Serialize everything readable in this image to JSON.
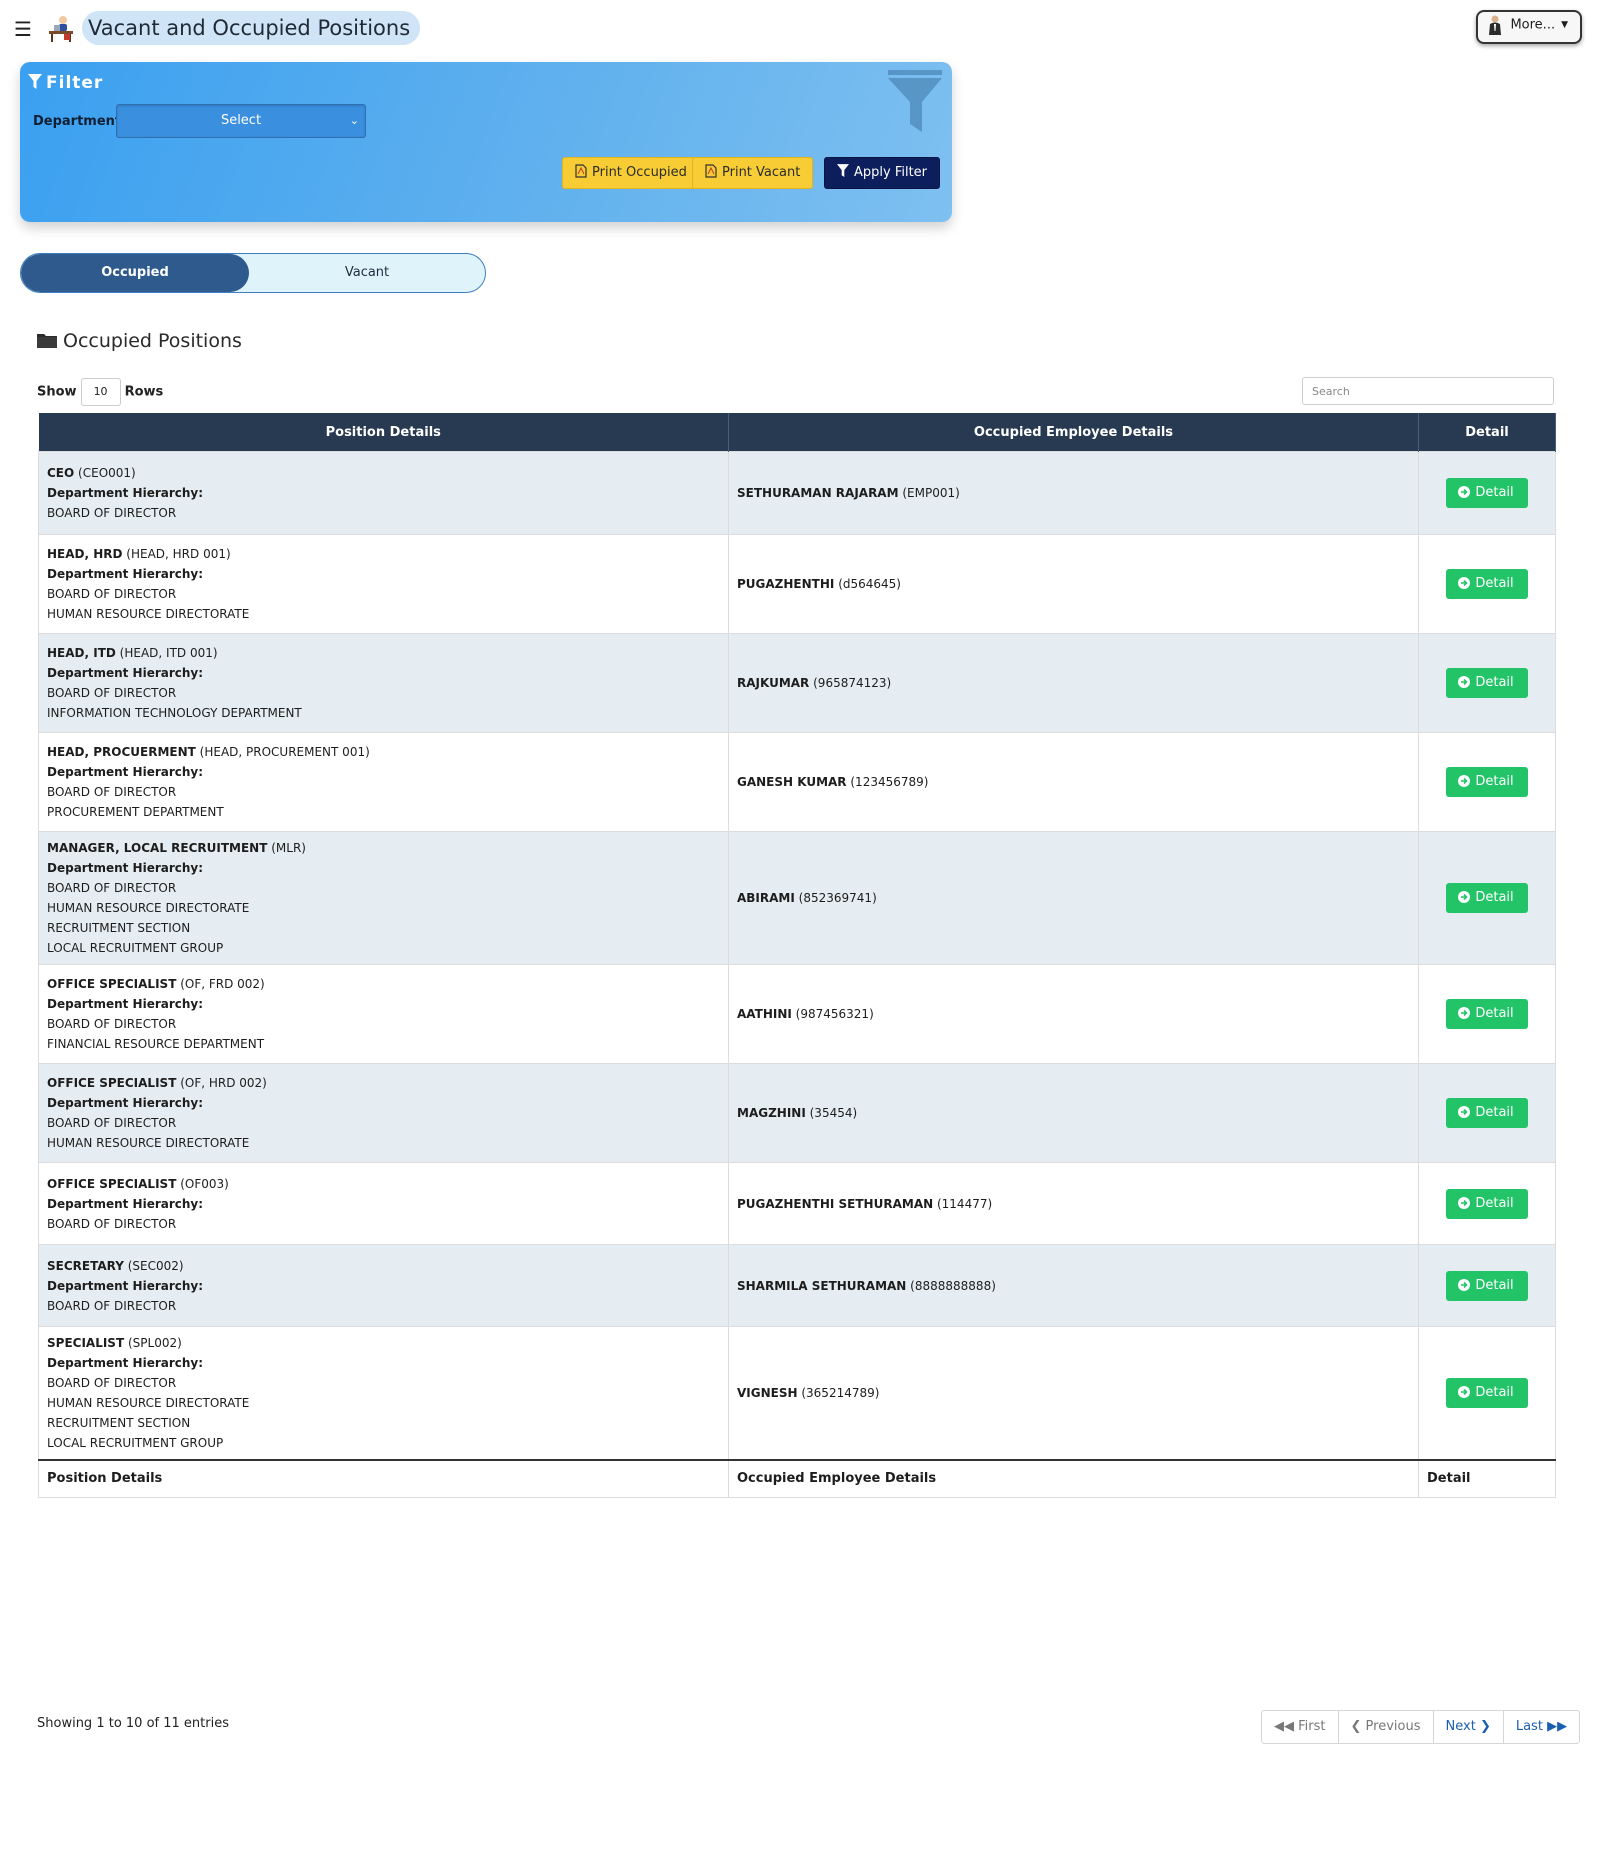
{
  "header": {
    "title": "Vacant and Occupied Positions",
    "more_label": "More..."
  },
  "filter": {
    "title": "Filter",
    "department_label": "Department:",
    "department_value": "Select",
    "print_occupied": "Print Occupied",
    "print_vacant": "Print Vacant",
    "apply_filter": "Apply Filter"
  },
  "toggle": {
    "occupied": "Occupied",
    "vacant": "Vacant"
  },
  "section": {
    "title": "Occupied Positions",
    "show_label": "Show",
    "rows_value": "10",
    "rows_label": "Rows",
    "search_placeholder": "Search"
  },
  "table": {
    "headers": [
      "Position Details",
      "Occupied Employee Details",
      "Detail"
    ],
    "hierarchy_label": "Department Hierarchy:",
    "detail_button": "Detail",
    "rows": [
      {
        "title": "CEO",
        "code": "(CEO001)",
        "hierarchy": [
          "BOARD OF DIRECTOR"
        ],
        "emp": "SETHURAMAN RAJARAM",
        "emp_id": "(EMP001)"
      },
      {
        "title": "HEAD, HRD",
        "code": "(HEAD, HRD 001)",
        "hierarchy": [
          "BOARD OF DIRECTOR",
          "HUMAN RESOURCE DIRECTORATE"
        ],
        "emp": "PUGAZHENTHI",
        "emp_id": "(d564645)"
      },
      {
        "title": "HEAD, ITD",
        "code": "(HEAD, ITD 001)",
        "hierarchy": [
          "BOARD OF DIRECTOR",
          "INFORMATION TECHNOLOGY DEPARTMENT"
        ],
        "emp": "RAJKUMAR",
        "emp_id": "(965874123)"
      },
      {
        "title": "HEAD, PROCUERMENT",
        "code": "(HEAD, PROCUREMENT 001)",
        "hierarchy": [
          "BOARD OF DIRECTOR",
          "PROCUREMENT DEPARTMENT"
        ],
        "emp": "GANESH KUMAR",
        "emp_id": "(123456789)"
      },
      {
        "title": "MANAGER, LOCAL RECRUITMENT",
        "code": "(MLR)",
        "hierarchy": [
          "BOARD OF DIRECTOR",
          "HUMAN RESOURCE DIRECTORATE",
          "RECRUITMENT SECTION",
          "LOCAL RECRUITMENT GROUP"
        ],
        "emp": "ABIRAMI",
        "emp_id": "(852369741)"
      },
      {
        "title": "OFFICE SPECIALIST",
        "code": "(OF, FRD 002)",
        "hierarchy": [
          "BOARD OF DIRECTOR",
          "FINANCIAL RESOURCE DEPARTMENT"
        ],
        "emp": "AATHINI",
        "emp_id": "(987456321)"
      },
      {
        "title": "OFFICE SPECIALIST",
        "code": "(OF, HRD 002)",
        "hierarchy": [
          "BOARD OF DIRECTOR",
          "HUMAN RESOURCE DIRECTORATE"
        ],
        "emp": "MAGZHINI",
        "emp_id": "(35454)"
      },
      {
        "title": "OFFICE SPECIALIST",
        "code": "(OF003)",
        "hierarchy": [
          "BOARD OF DIRECTOR"
        ],
        "emp": "PUGAZHENTHI SETHURAMAN",
        "emp_id": "(114477)"
      },
      {
        "title": "SECRETARY",
        "code": "(SEC002)",
        "hierarchy": [
          "BOARD OF DIRECTOR"
        ],
        "emp": "SHARMILA SETHURAMAN",
        "emp_id": "(8888888888)"
      },
      {
        "title": "SPECIALIST",
        "code": "(SPL002)",
        "hierarchy": [
          "BOARD OF DIRECTOR",
          "HUMAN RESOURCE DIRECTORATE",
          "RECRUITMENT SECTION",
          "LOCAL RECRUITMENT GROUP"
        ],
        "emp": "VIGNESH",
        "emp_id": "(365214789)"
      }
    ]
  },
  "footer": {
    "info": "Showing 1 to 10 of 11 entries",
    "first": "First",
    "previous": "Previous",
    "next": "Next",
    "last": "Last"
  },
  "colors": {
    "header_bg": "#273a52",
    "row_odd": "#e6edf2",
    "detail_green": "#23c468",
    "print_yellow": "#f7cc35",
    "apply_navy": "#0d1e5c",
    "toggle_active": "#2e5a8e"
  },
  "icons": {
    "menu": "hamburger-icon",
    "title": "desk-person-icon",
    "user": "user-avatar-icon",
    "filter": "funnel-icon",
    "pdf": "pdf-file-icon",
    "folder": "folder-icon",
    "detail": "arrow-circle-right-icon"
  }
}
